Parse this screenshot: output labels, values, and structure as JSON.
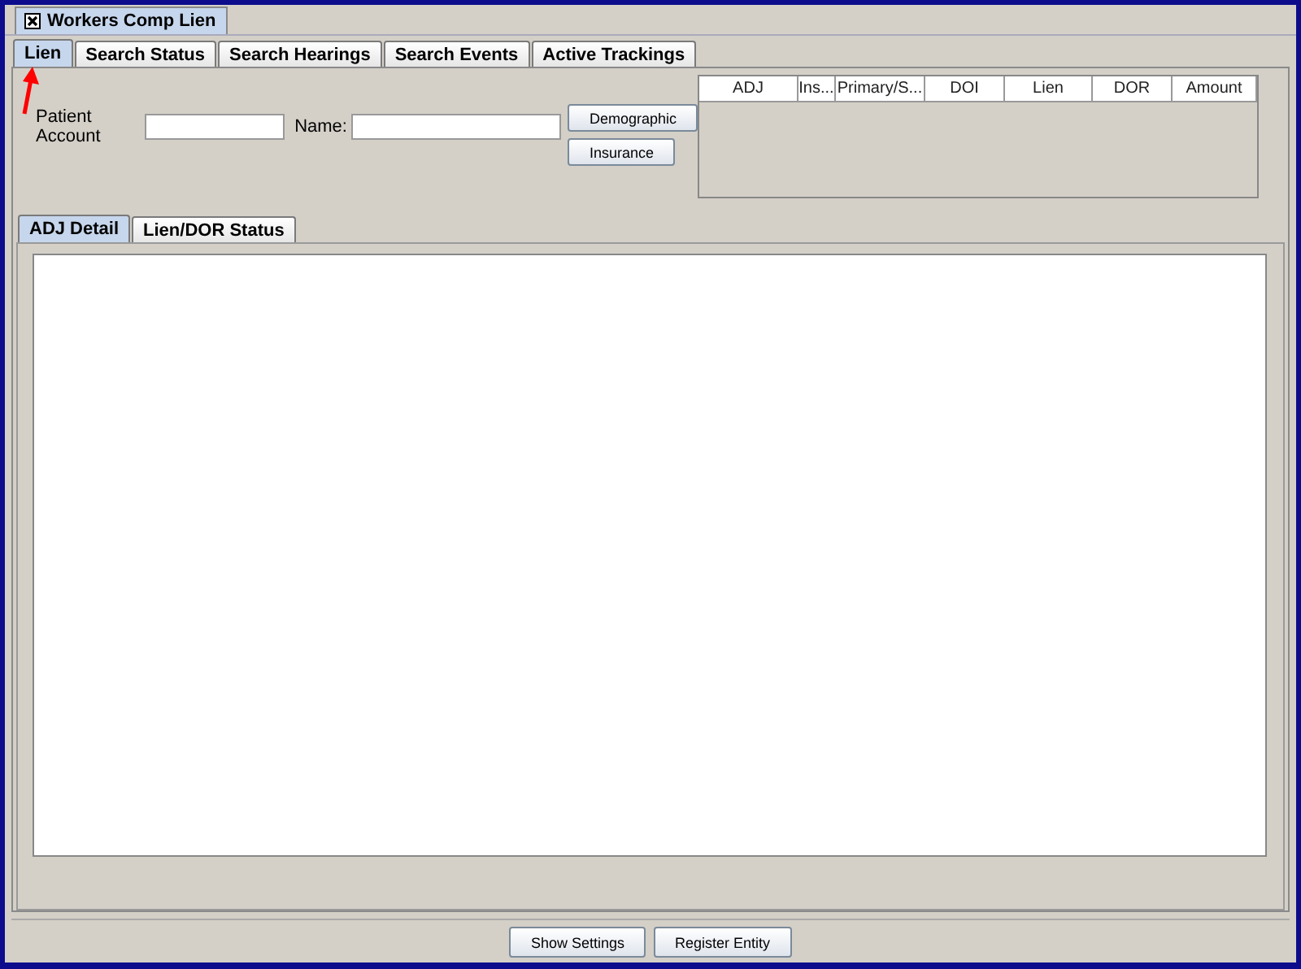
{
  "window": {
    "title": "Workers Comp Lien"
  },
  "tabs": [
    {
      "label": "Lien",
      "selected": true
    },
    {
      "label": "Search Status",
      "selected": false
    },
    {
      "label": "Search Hearings",
      "selected": false
    },
    {
      "label": "Search Events",
      "selected": false
    },
    {
      "label": "Active Trackings",
      "selected": false
    }
  ],
  "form": {
    "patient_account_label": "Patient Account",
    "name_label": "Name:",
    "buttons": [
      "Demographic",
      "Insurance"
    ]
  },
  "table": {
    "columns": [
      "ADJ",
      "Ins...",
      "Primary/S...",
      "DOI",
      "Lien",
      "DOR",
      "Amount"
    ]
  },
  "detail_tabs": [
    {
      "label": "ADJ Detail",
      "selected": true
    },
    {
      "label": "Lien/DOR Status",
      "selected": false
    }
  ],
  "footer_buttons": [
    "Show Settings",
    "Register Entity"
  ]
}
